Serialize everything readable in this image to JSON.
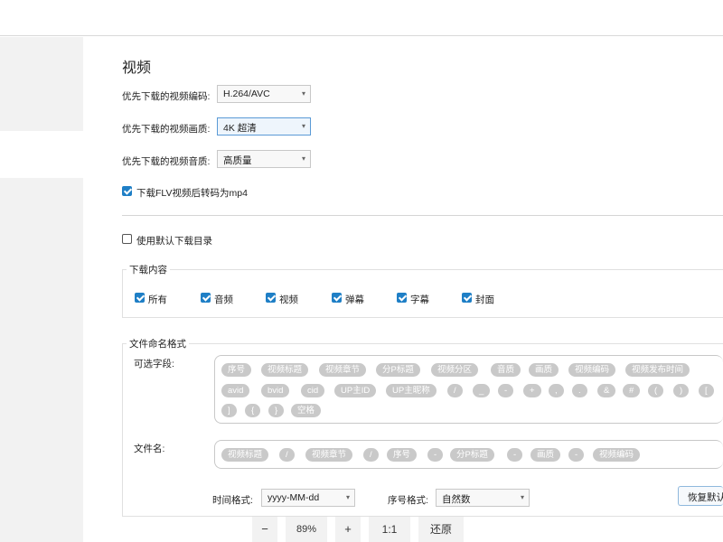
{
  "section_title": "视频",
  "video_codec": {
    "label": "优先下载的视频编码:",
    "value": "H.264/AVC"
  },
  "video_quality": {
    "label": "优先下载的视频画质:",
    "value": "4K 超清"
  },
  "audio_quality": {
    "label": "优先下载的视频音质:",
    "value": "高质量"
  },
  "flv_to_mp4": {
    "label": "下载FLV视频后转码为mp4",
    "checked": true
  },
  "default_dir": {
    "label": "使用默认下载目录",
    "checked": false
  },
  "download_content": {
    "title": "下载内容",
    "items": [
      {
        "label": "所有",
        "checked": true
      },
      {
        "label": "音频",
        "checked": true
      },
      {
        "label": "视频",
        "checked": true
      },
      {
        "label": "弹幕",
        "checked": true
      },
      {
        "label": "字幕",
        "checked": true
      },
      {
        "label": "封面",
        "checked": true
      }
    ]
  },
  "file_naming": {
    "title": "文件命名格式",
    "optional_fields_label": "可选字段:",
    "optional_fields": [
      "序号",
      "视频标题",
      "视频章节",
      "分P标题",
      "视频分区",
      "音质",
      "画质",
      "视频编码",
      "视频发布时间",
      "avid",
      "bvid",
      "cid",
      "UP主ID",
      "UP主昵称",
      "/",
      "_",
      "-",
      "+",
      ",",
      ".",
      "&",
      "#",
      "(",
      ")",
      "[",
      "]",
      "{",
      "}",
      "空格"
    ],
    "filename_label": "文件名:",
    "filename_tokens": [
      "视频标题",
      "/",
      "视频章节",
      "/",
      "序号",
      "-",
      "分P标题",
      "-",
      "画质",
      "-",
      "视频编码"
    ],
    "time_format_label": "时间格式:",
    "time_format_value": "yyyy-MM-dd",
    "index_format_label": "序号格式:",
    "index_format_value": "自然数",
    "restore_default_label": "恢复默认"
  },
  "zoom": {
    "minus": "−",
    "value": "89%",
    "plus": "+",
    "one_to_one": "1:1",
    "restore": "还原"
  }
}
